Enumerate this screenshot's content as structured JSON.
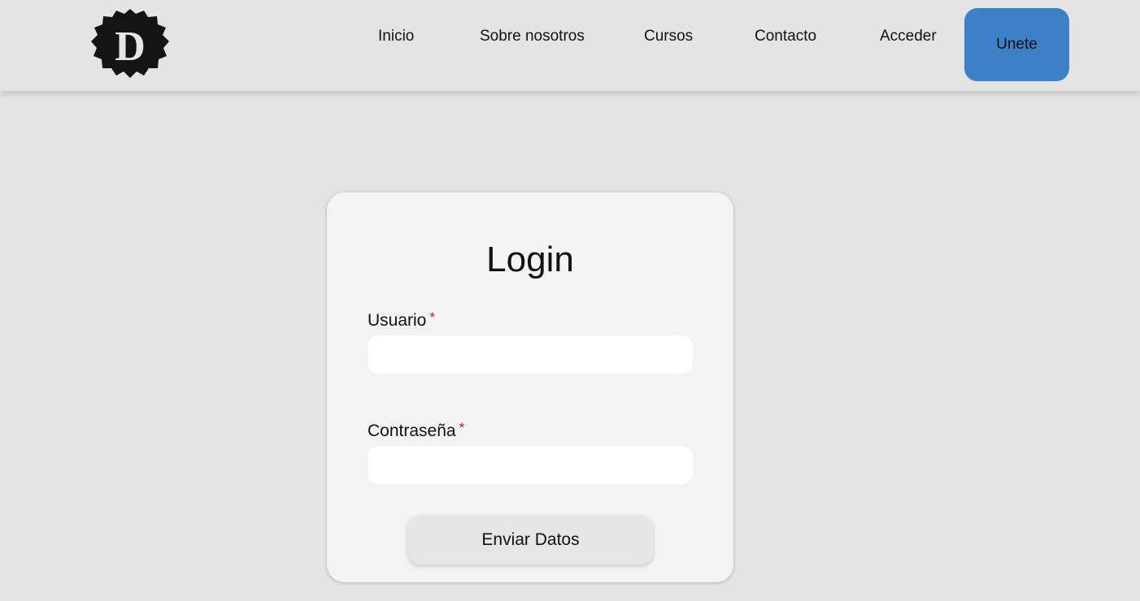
{
  "header": {
    "logo": {
      "letter": "D",
      "color": "#141414",
      "letter_color": "#e6e6e6"
    },
    "nav": [
      {
        "label": "Inicio"
      },
      {
        "label": "Sobre nosotros"
      },
      {
        "label": "Cursos"
      },
      {
        "label": "Contacto"
      },
      {
        "label": "Acceder"
      }
    ],
    "join_button": {
      "label": "Unete",
      "color": "#3d80c7"
    }
  },
  "login": {
    "title": "Login",
    "username": {
      "label": "Usuario",
      "required_mark": "*",
      "value": "",
      "placeholder": ""
    },
    "password": {
      "label": "Contraseña",
      "required_mark": "*",
      "value": "",
      "placeholder": ""
    },
    "submit_label": "Enviar Datos",
    "required_color": "#c21b1b"
  }
}
